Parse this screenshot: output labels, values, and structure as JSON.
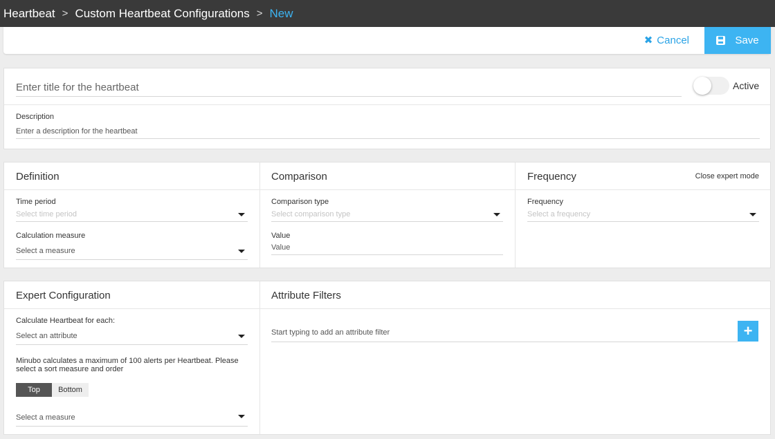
{
  "breadcrumb": {
    "items": [
      "Heartbeat",
      "Custom Heartbeat Configurations"
    ],
    "current": "New",
    "separator": ">"
  },
  "actions": {
    "cancel_label": "Cancel",
    "save_label": "Save"
  },
  "heartbeat": {
    "title_placeholder": "Enter title for the heartbeat",
    "active_label": "Active",
    "active": false,
    "description_label": "Description",
    "description_placeholder": "Enter a description for the heartbeat"
  },
  "definition": {
    "title": "Definition",
    "time_period_label": "Time period",
    "time_period_placeholder": "Select time period",
    "calc_measure_label": "Calculation measure",
    "calc_measure_placeholder": "Select a measure"
  },
  "comparison": {
    "title": "Comparison",
    "type_label": "Comparison type",
    "type_placeholder": "Select comparison type",
    "value_label": "Value",
    "value_placeholder": "Value"
  },
  "frequency": {
    "title": "Frequency",
    "expert_mode_link": "Close expert mode",
    "frequency_label": "Frequency",
    "frequency_placeholder": "Select a frequency"
  },
  "expert": {
    "title": "Expert Configuration",
    "calc_for_each_label": "Calculate Heartbeat for each:",
    "attribute_placeholder": "Select an attribute",
    "note": "Minubo calculates a maximum of 100 alerts per Heartbeat. Please select a sort measure and order",
    "order_top": "Top",
    "order_bottom": "Bottom",
    "order_selected": "Top",
    "sort_measure_placeholder": "Select a measure"
  },
  "attribute_filters": {
    "title": "Attribute Filters",
    "input_placeholder": "Start typing to add an attribute filter"
  },
  "colors": {
    "accent": "#3db4f2",
    "topbar": "#3a3a3a"
  }
}
